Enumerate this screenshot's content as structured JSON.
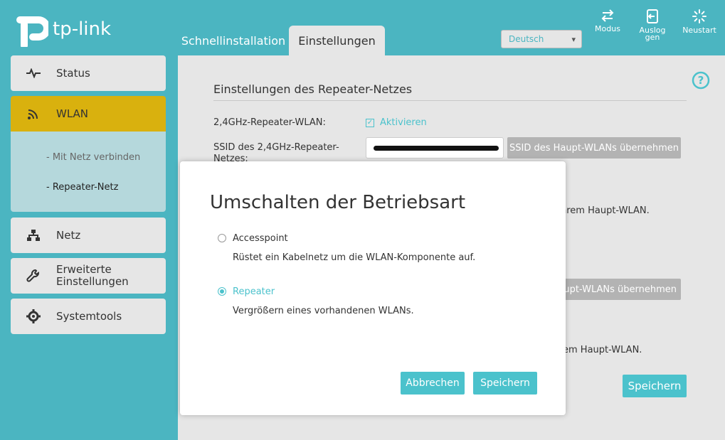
{
  "brand": {
    "name": "tp-link"
  },
  "tabs": {
    "quick_setup": "Schnellinstallation",
    "settings": "Einstellungen"
  },
  "language": {
    "selected": "Deutsch"
  },
  "header_buttons": {
    "mode": "Modus",
    "logout": "Ausloggen",
    "reboot": "Neustart"
  },
  "sidebar": {
    "status": "Status",
    "wlan": "WLAN",
    "wlan_sub": [
      "- Mit Netz verbinden",
      "- Repeater-Netz"
    ],
    "network": "Netz",
    "advanced": "Erweiterte Einstellungen",
    "system": "Systemtools"
  },
  "main": {
    "section_title": "Einstellungen des Repeater-Netzes",
    "repeater_24_label": "2,4GHz-Repeater-WLAN:",
    "activate_label": "Aktivieren",
    "ssid_24_label": "SSID des 2,4GHz-Repeater-Netzes:",
    "copy_ssid_button": "SSID des Haupt-WLANs übernehmen",
    "copy_ssid_button_2_visible": "upt-WLANs übernehmen",
    "hint_1_visible": "hrem Haupt-WLAN.",
    "hint_2_visible": "em Haupt-WLAN.",
    "save_button": "Speichern"
  },
  "modal": {
    "title": "Umschalten der Betriebsart",
    "options": [
      {
        "label": "Accesspoint",
        "desc": "Rüstet ein Kabelnetz um die WLAN-Komponente auf.",
        "selected": false
      },
      {
        "label": "Repeater",
        "desc": "Vergrößern eines vorhandenen WLANs.",
        "selected": true
      }
    ],
    "cancel": "Abbrechen",
    "save": "Speichern"
  },
  "colors": {
    "teal": "#4bb5c1",
    "accent": "#4bc2cc",
    "wlan_active": "#d9b10e"
  }
}
